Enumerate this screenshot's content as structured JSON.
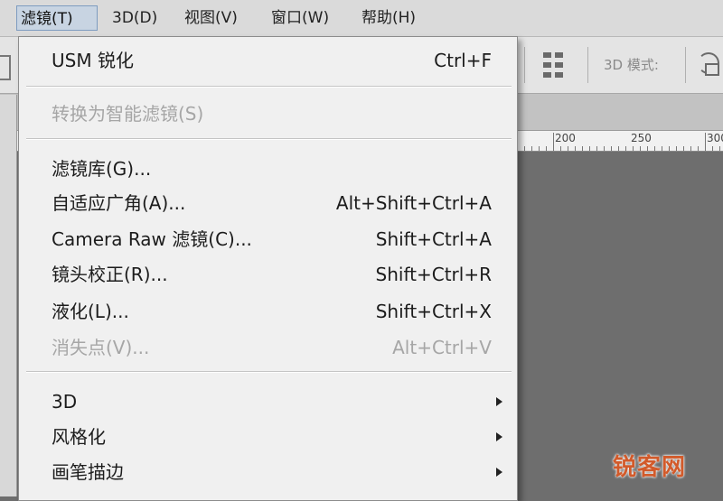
{
  "menubar": {
    "items": [
      {
        "label": "滤镜(T)",
        "active": true
      },
      {
        "label": "3D(D)"
      },
      {
        "label": "视图(V)"
      },
      {
        "label": "窗口(W)"
      },
      {
        "label": "帮助(H)"
      }
    ]
  },
  "optbar": {
    "mode_label": "3D 模式:"
  },
  "ruler": {
    "labels": [
      "200",
      "250",
      "300"
    ]
  },
  "filter_menu": {
    "items": [
      {
        "label": "USM 锐化",
        "shortcut": "Ctrl+F"
      },
      {
        "label": "转换为智能滤镜(S)",
        "disabled": true
      },
      {
        "label": "滤镜库(G)..."
      },
      {
        "label": "自适应广角(A)...",
        "shortcut": "Alt+Shift+Ctrl+A"
      },
      {
        "label": "Camera Raw 滤镜(C)...",
        "shortcut": "Shift+Ctrl+A"
      },
      {
        "label": "镜头校正(R)...",
        "shortcut": "Shift+Ctrl+R"
      },
      {
        "label": "液化(L)...",
        "shortcut": "Shift+Ctrl+X"
      },
      {
        "label": "消失点(V)...",
        "shortcut": "Alt+Ctrl+V",
        "disabled": true
      },
      {
        "label": "3D",
        "submenu": true
      },
      {
        "label": "风格化",
        "submenu": true
      },
      {
        "label": "画笔描边",
        "submenu": true
      }
    ]
  },
  "watermark": {
    "text": "锐客网"
  },
  "colors": {
    "menu_highlight": "#c8d4e2",
    "disabled_text": "#a6a6a6",
    "watermark": "#d25a2a"
  }
}
